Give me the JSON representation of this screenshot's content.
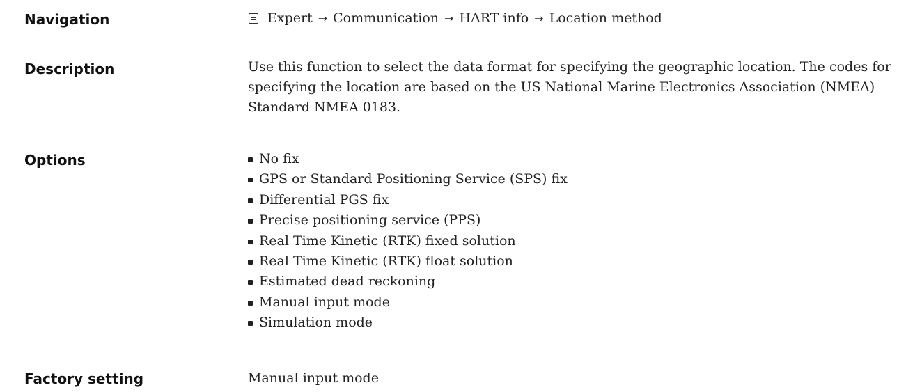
{
  "navigation": {
    "label": "Navigation",
    "icon": "menu-icon",
    "path": [
      "Expert",
      "Communication",
      "HART info",
      "Location method"
    ],
    "separator": "→"
  },
  "description": {
    "label": "Description",
    "text": "Use this function to select the data format for specifying the geographic location. The codes for specifying the location are based on the US National Marine Electronics Association (NMEA) Standard NMEA 0183."
  },
  "options": {
    "label": "Options",
    "items": [
      "No fix",
      "GPS or Standard Positioning Service (SPS) fix",
      "Differential PGS fix",
      "Precise positioning service (PPS)",
      "Real Time Kinetic (RTK) fixed solution",
      "Real Time Kinetic (RTK) float solution",
      "Estimated dead reckoning",
      "Manual input mode",
      "Simulation mode"
    ]
  },
  "factory_setting": {
    "label": "Factory setting",
    "value": "Manual input mode"
  }
}
